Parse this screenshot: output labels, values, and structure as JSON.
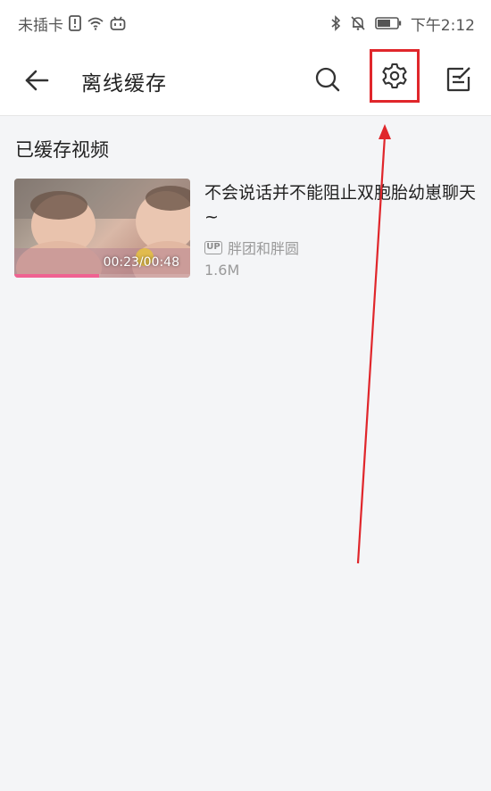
{
  "status_bar": {
    "carrier": "未插卡",
    "time": "下午2:12",
    "icons": [
      "sim-alert-icon",
      "wifi-icon",
      "bilibili-icon",
      "bluetooth-icon",
      "mute-bell-icon",
      "battery-icon"
    ]
  },
  "app_bar": {
    "title": "离线缓存",
    "back_icon": "back-arrow-icon",
    "search_icon": "search-icon",
    "settings_icon": "gear-icon",
    "edit_icon": "edit-icon",
    "highlight_color": "#e0262b"
  },
  "section": {
    "title": "已缓存视频"
  },
  "videos": [
    {
      "title": "不会说话并不能阻止双胞胎幼崽聊天 ~",
      "duration": "00:23/00:48",
      "progress": 0.48,
      "up_badge": "UP",
      "uploader": "胖团和胖圆",
      "size": "1.6M"
    }
  ],
  "colors": {
    "background": "#f4f5f7",
    "bar": "#ffffff",
    "progress": "#f06292",
    "annotation_arrow": "#e0262b"
  }
}
